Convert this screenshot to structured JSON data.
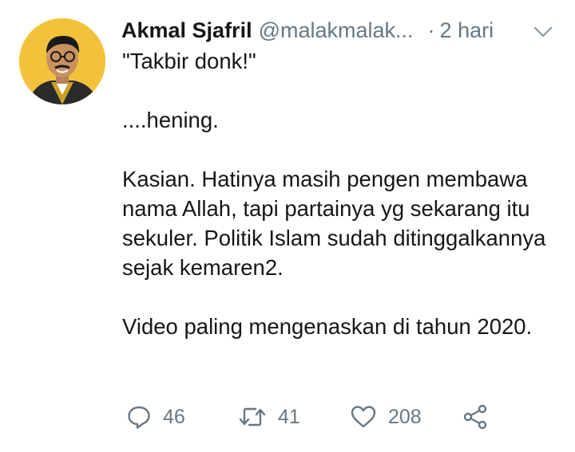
{
  "tweet": {
    "author_name": "Akmal Sjafril",
    "author_handle": "@malakmalak...",
    "time_separator": "·",
    "time": "2 hari",
    "paragraphs": [
      "\"Takbir donk!\"",
      "....hening.",
      "Kasian. Hatinya masih pengen membawa nama Allah, tapi partainya yg sekarang itu sekuler. Politik Islam sudah ditinggalkannya sejak kemaren2.",
      "Video paling mengenaskan di tahun 2020."
    ],
    "reply_count": "46",
    "retweet_count": "41",
    "like_count": "208"
  },
  "colors": {
    "text": "#14171a",
    "muted": "#657786",
    "avatar_bg": "#f2c33a"
  },
  "icons": {
    "reply": "speech-bubble",
    "retweet": "retweet-arrows",
    "like": "heart",
    "share": "share-nodes",
    "menu": "chevron-down",
    "avatar": "illustrated-portrait"
  }
}
